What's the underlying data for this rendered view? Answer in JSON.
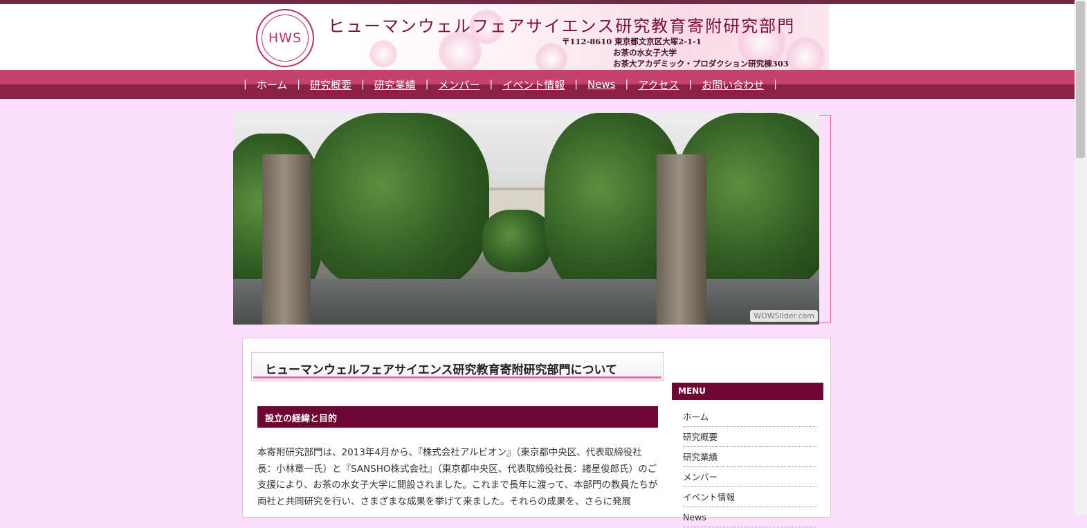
{
  "header": {
    "logo_text": "HWS",
    "title": "ヒューマンウェルフェアサイエンス研究教育寄附研究部門",
    "address_line1": "〒112-8610  東京都文京区大塚2-1-1",
    "address_line2": "お茶の水女子大学",
    "address_line3": "お茶大アカデミック・プロダクション研究棟303"
  },
  "nav": {
    "separator": "|",
    "items": [
      {
        "label": "ホーム"
      },
      {
        "label": "研究概要"
      },
      {
        "label": "研究業績"
      },
      {
        "label": "メンバー"
      },
      {
        "label": "イベント情報"
      },
      {
        "label": "News"
      },
      {
        "label": "アクセス"
      },
      {
        "label": "お問い合わせ"
      }
    ]
  },
  "slider": {
    "credit": "WOWSlider.com"
  },
  "main": {
    "heading": "ヒューマンウェルフェアサイエンス研究教育寄附研究部門について",
    "section_heading": "設立の経緯と目的",
    "paragraph": "本寄附研究部門は、2013年4月から、『株式会社アルビオン』（東京都中央区、代表取締役社長：小林章一氏）と『SANSHO株式会社』（東京都中央区、代表取締役社長：諸星俊郎氏）のご支援により、お茶の水女子大学に開設されました。これまで長年に渡って、本部門の教員たちが両社と共同研究を行い、さまざまな成果を挙げて来ました。それらの成果を、さらに発展"
  },
  "sidebar": {
    "menu_title": "MENU",
    "items": [
      {
        "label": "ホーム"
      },
      {
        "label": "研究概要"
      },
      {
        "label": "研究業績"
      },
      {
        "label": "メンバー"
      },
      {
        "label": "イベント情報"
      },
      {
        "label": "News"
      }
    ]
  },
  "colors": {
    "accent": "#6e0634",
    "nav_top": "#c4426e",
    "nav_bottom": "#8a2146",
    "page_bg": "#fce0fb",
    "pink_line": "#e86aa8"
  }
}
